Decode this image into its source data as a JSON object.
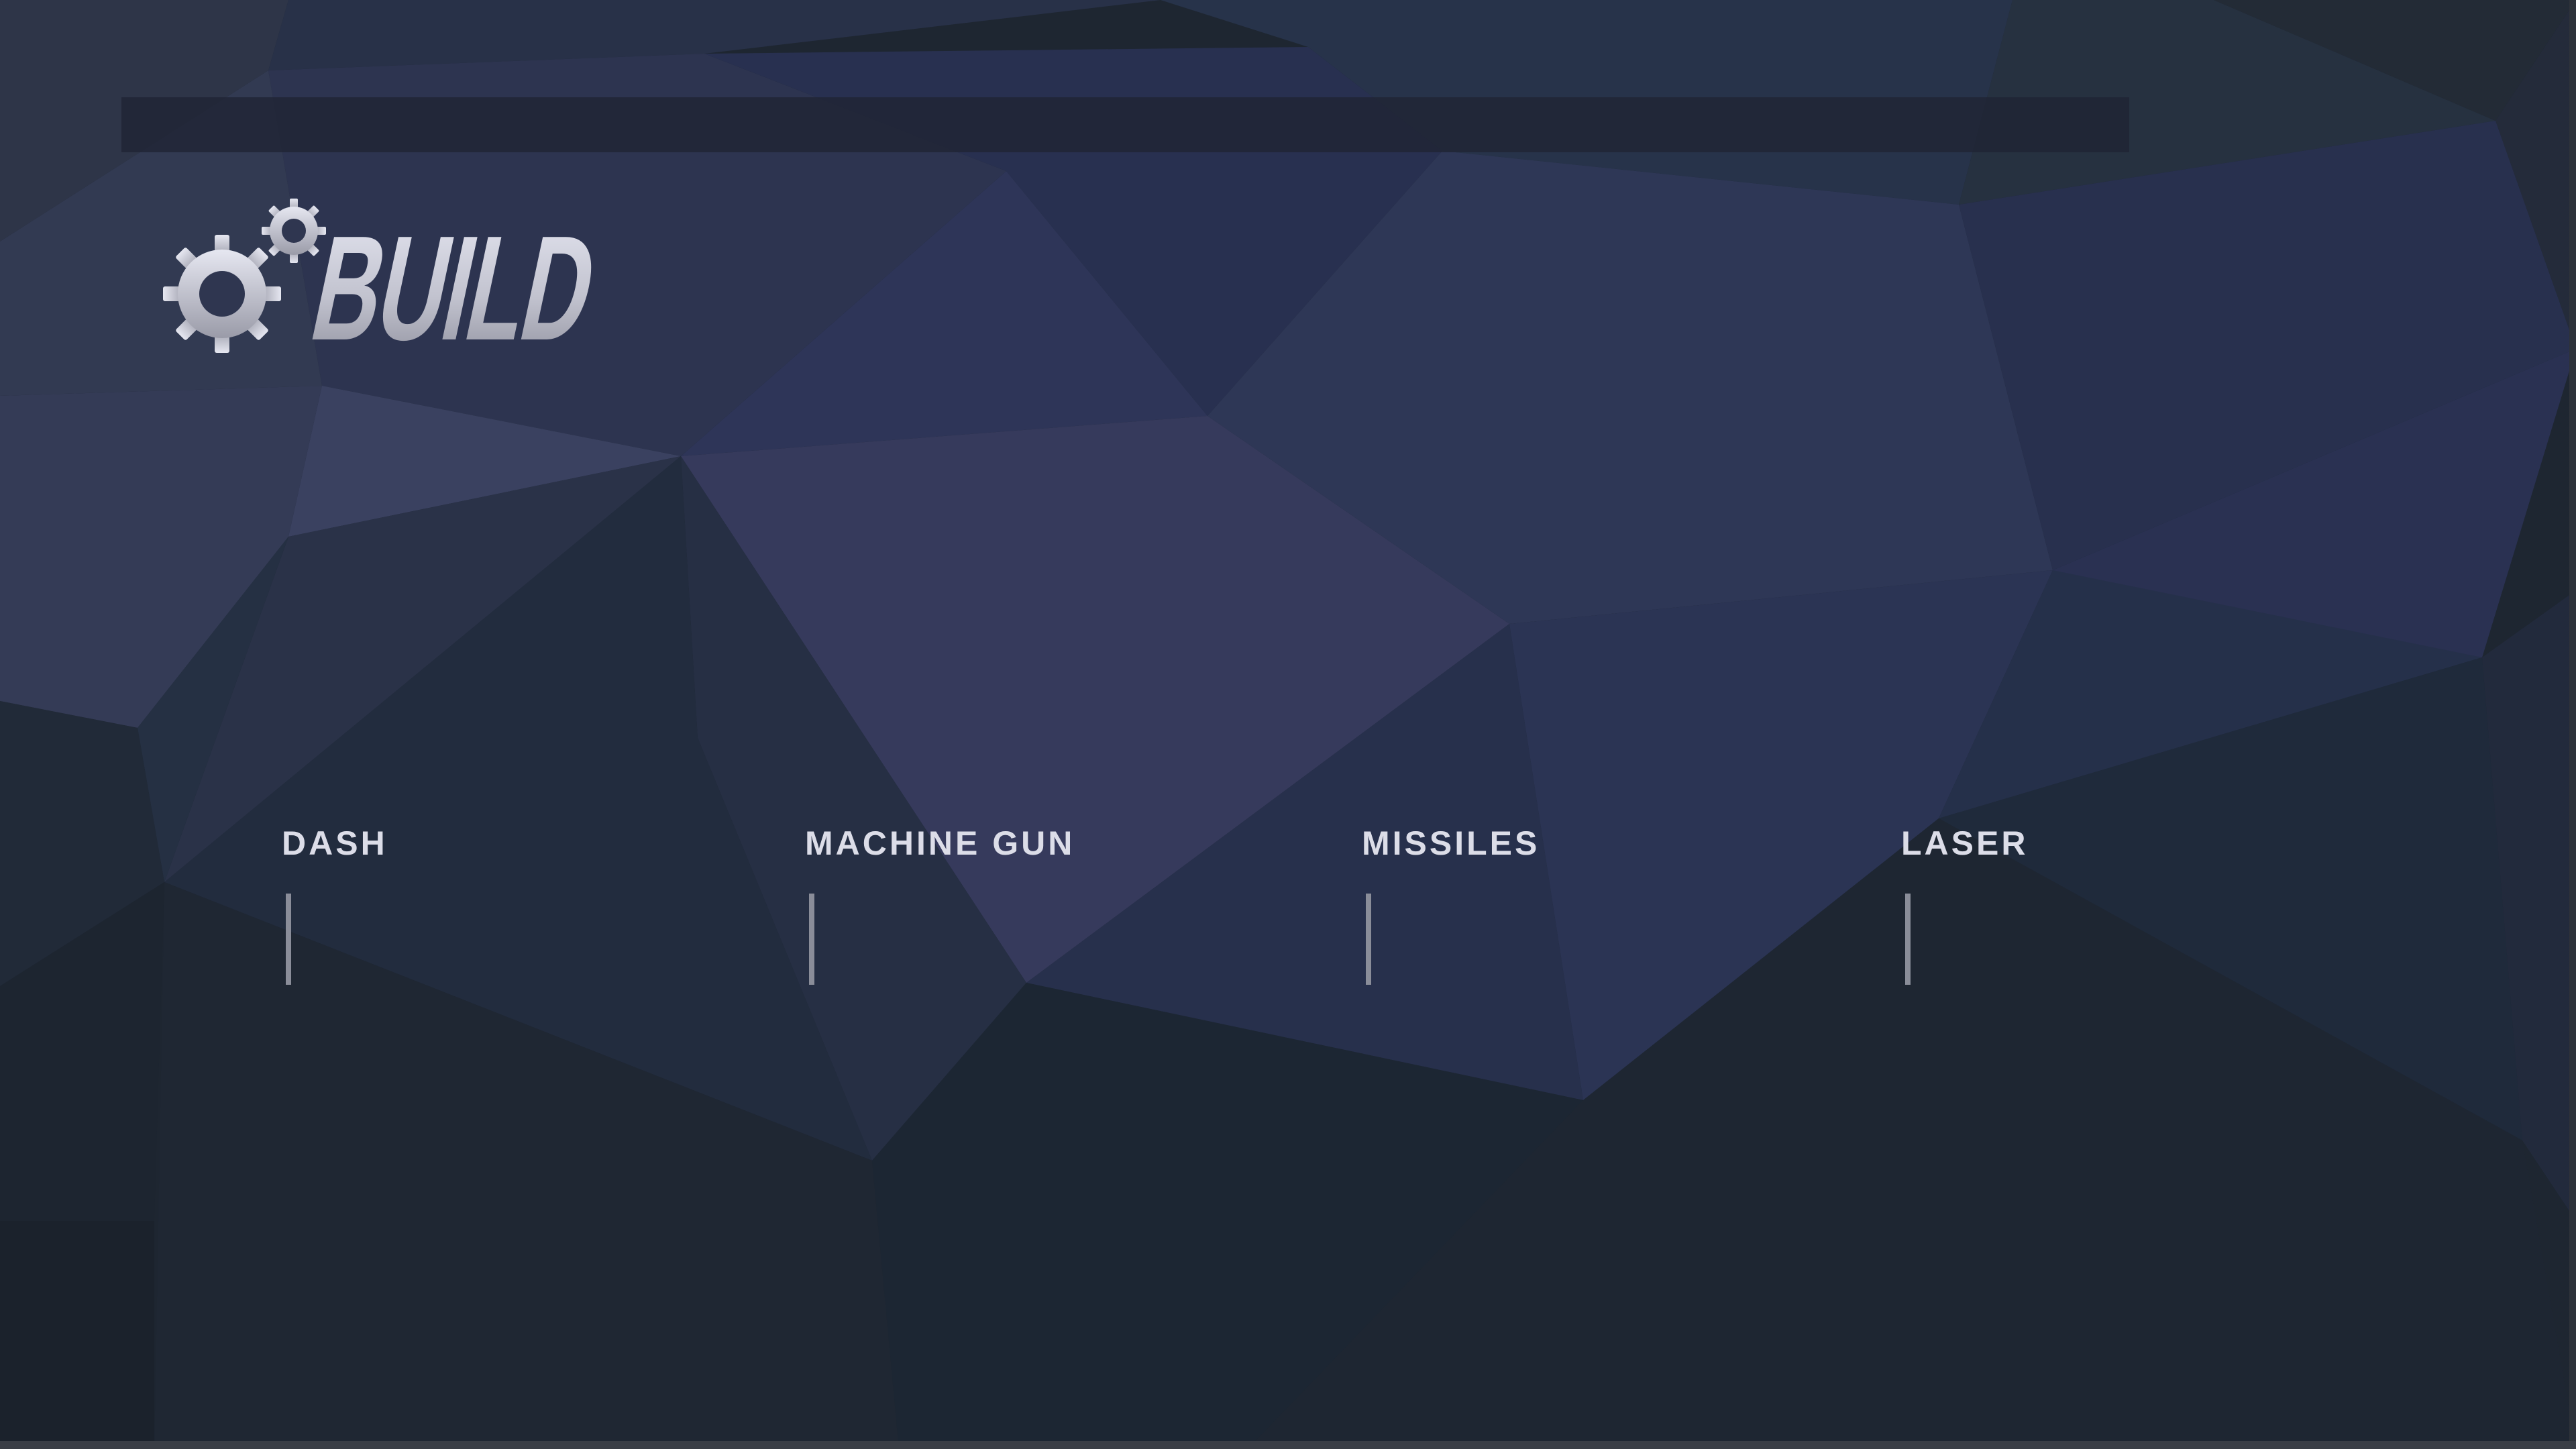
{
  "screen": {
    "title": "BUILD",
    "title_icon": "gears-icon"
  },
  "weapons": [
    {
      "label": "DASH",
      "level": 0
    },
    {
      "label": "MACHINE GUN",
      "level": 0
    },
    {
      "label": "MISSILES",
      "level": 0
    },
    {
      "label": "LASER",
      "level": 0
    }
  ],
  "colors": {
    "background_dark": "#1e2631",
    "background_indigo": "#2f3558",
    "label_text": "#dcdde8",
    "level_bar": "#8a8d99"
  }
}
